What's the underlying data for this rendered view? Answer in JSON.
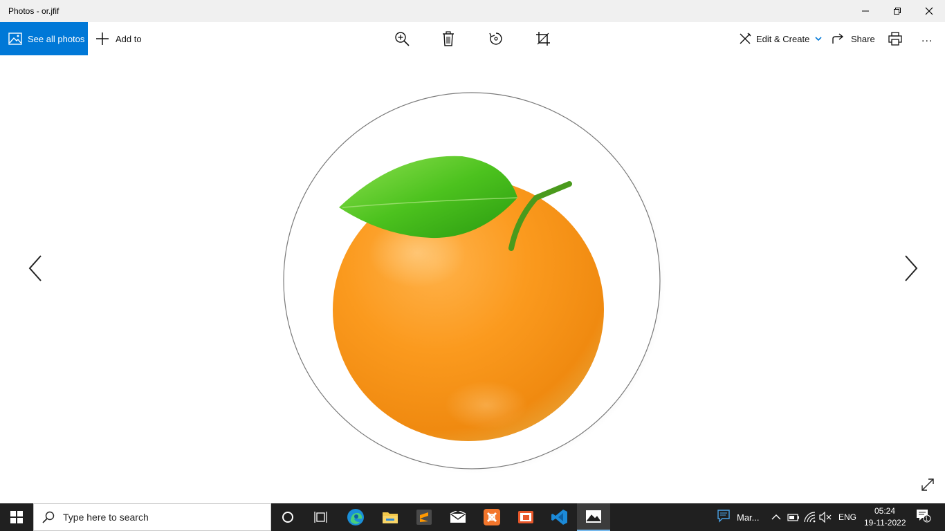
{
  "window": {
    "title": "Photos - or.jfif"
  },
  "toolbar": {
    "see_all_label": "See all photos",
    "add_to_label": "Add to",
    "edit_create_label": "Edit & Create",
    "share_label": "Share",
    "more_label": "..."
  },
  "viewer": {
    "image_subject": "orange-fruit-with-leaf",
    "background_color": "#ffffff"
  },
  "taskbar": {
    "search_placeholder": "Type here to search",
    "pinned_apps": [
      "cortana",
      "task-view",
      "edge",
      "file-explorer",
      "sublime-text",
      "mail",
      "xampp",
      "app-orange",
      "vscode",
      "photos"
    ],
    "tray_app_label": "Mar...",
    "language": "ENG",
    "time": "05:24",
    "date": "19-11-2022",
    "notification_count": "1"
  },
  "colors": {
    "accent": "#0078d7",
    "taskbar_bg": "#202020",
    "titlebar_bg": "#f0f0f0"
  }
}
